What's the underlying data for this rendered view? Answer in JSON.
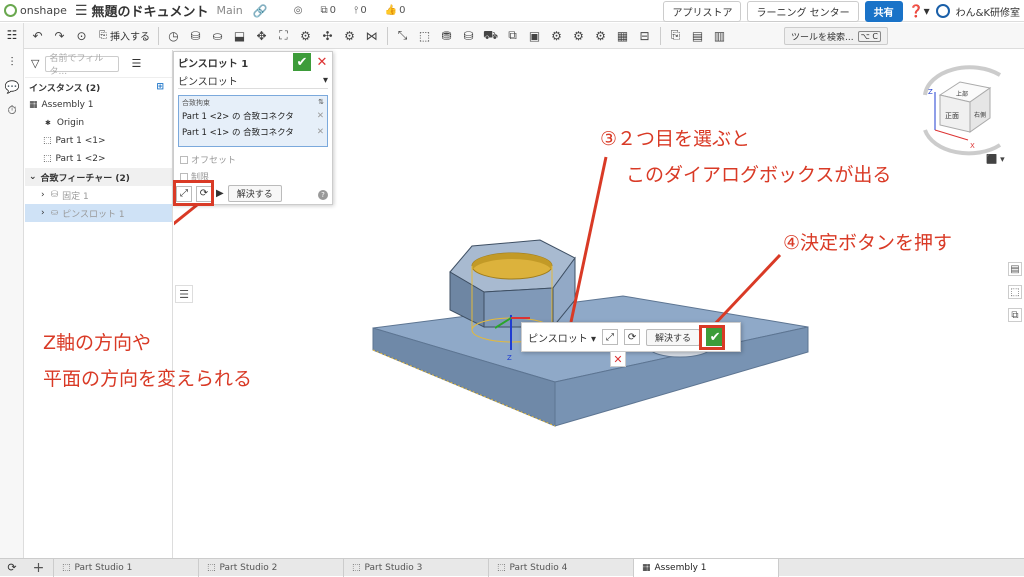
{
  "app": {
    "logo_text": "onshape",
    "doc_title": "無題のドキュメント",
    "branch": "Main"
  },
  "stats": [
    {
      "icon": "globe-icon",
      "value": ""
    },
    {
      "icon": "copy-icon",
      "value": "0"
    },
    {
      "icon": "pin-icon",
      "value": "0"
    },
    {
      "icon": "thumbs-up-icon",
      "value": "0"
    }
  ],
  "top_buttons": {
    "app_store": "アプリストア",
    "learning": "ラーニング センター",
    "share": "共有",
    "help": "?",
    "user": "わん&K研修室"
  },
  "toolbar": {
    "insert": "挿入する",
    "search": "ツールを検索...",
    "shortcut": "⌥ C"
  },
  "panel": {
    "filter_placeholder": "名前でフィルタ...",
    "instances_header": "インスタンス (2)",
    "instances": [
      {
        "label": "Assembly 1"
      },
      {
        "label": "Origin"
      },
      {
        "label": "Part 1 <1>"
      },
      {
        "label": "Part 1 <2>"
      }
    ],
    "mate_features_header": "合致フィーチャー (2)",
    "mate_features": [
      {
        "label": "固定 1"
      },
      {
        "label": "ピンスロット 1"
      }
    ]
  },
  "mate_dialog": {
    "title": "ピンスロット 1",
    "type": "ピンスロット",
    "box_label": "合致拘束",
    "connectors": [
      "Part 1 <2> の 合致コネクタ",
      "Part 1 <1> の 合致コネクタ"
    ],
    "offset": "オフセット",
    "limits": "制限",
    "solve": "解決する"
  },
  "mini_dialog": {
    "type": "ピンスロット",
    "solve": "解決する"
  },
  "annotations": {
    "select_second": "③２つ目を選ぶと",
    "dialog_appears": "このダイアログボックスが出る",
    "press_ok": "④決定ボタンを押す",
    "z_axis": "Z軸の方向や",
    "plane": "平面の方向を変えられる"
  },
  "viewcube": {
    "top": "上部",
    "front": "正面",
    "right": "右側",
    "axis_z": "Z",
    "axis_x": "X"
  },
  "triad": {
    "z": "Z"
  },
  "tabs": [
    {
      "label": "Part Studio 1",
      "active": false
    },
    {
      "label": "Part Studio 2",
      "active": false
    },
    {
      "label": "Part Studio 3",
      "active": false
    },
    {
      "label": "Part Studio 4",
      "active": false
    },
    {
      "label": "Assembly 1",
      "active": true
    }
  ],
  "colors": {
    "accent": "#1a73c8",
    "ok_green": "#3d9c3a",
    "annotation_red": "#d93a26",
    "part_blue": "#7e9ab8",
    "hole_yellow": "#d6ad3c"
  }
}
